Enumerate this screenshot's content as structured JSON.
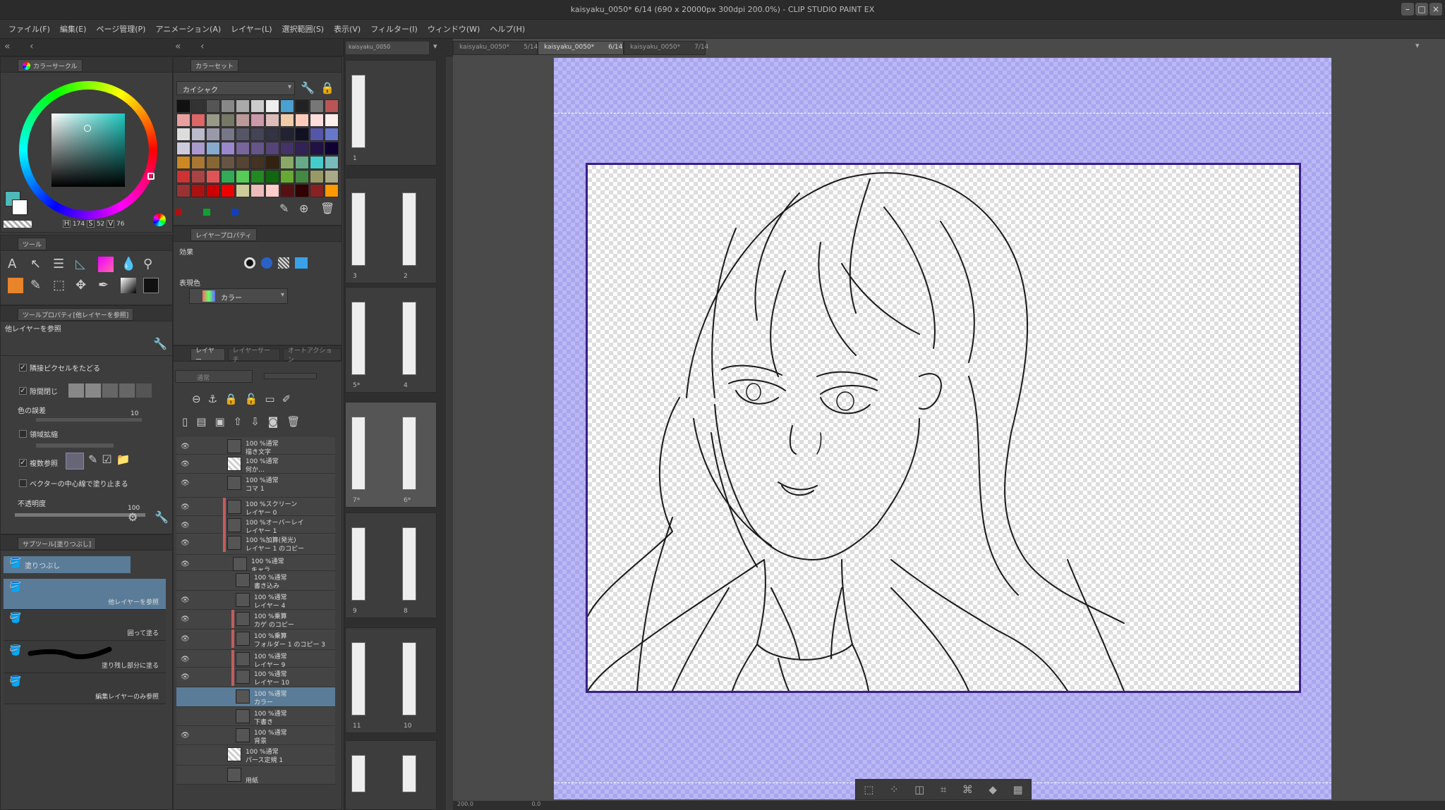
{
  "window": {
    "title": "kaisyaku_0050* 6/14 (690 x 20000px 300dpi 200.0%) - CLIP STUDIO PAINT EX"
  },
  "menu": [
    "ファイル(F)",
    "編集(E)",
    "ページ管理(P)",
    "アニメーション(A)",
    "レイヤー(L)",
    "選択範囲(S)",
    "表示(V)",
    "フィルター(I)",
    "ウィンドウ(W)",
    "ヘルプ(H)"
  ],
  "color_panel": {
    "tab": "カラーサークル",
    "h": "174",
    "s": "52",
    "v": "76",
    "h_label": "H",
    "s_label": "S",
    "v_label": "V",
    "main_color": "#4fb8b8",
    "sub_color": "#ffffff"
  },
  "color_set": {
    "tab": "カラーセット",
    "set_name": "カイシャク"
  },
  "tool_panel": {
    "tab": "ツール"
  },
  "tool_property": {
    "tab": "ツールプロパティ[他レイヤーを参照]",
    "header": "他レイヤーを参照",
    "opt1": "隣接ピクセルをたどる",
    "opt2": "隙間閉じ",
    "opt3": "色の誤差",
    "opt3_value": "10",
    "opt4": "領域拡縮",
    "opt5": "複数参照",
    "opt6": "ベクターの中心線で塗り止まる",
    "opt7": "不透明度",
    "opt7_value": "100"
  },
  "sub_tool": {
    "tab": "サブツール[塗りつぶし]",
    "header": "塗りつぶし",
    "items": [
      "他レイヤーを参照",
      "囲って塗る",
      "塗り残し部分に塗る",
      "編集レイヤーのみ参照"
    ]
  },
  "layer_property": {
    "tab": "レイヤープロパティ",
    "effect_label": "効果",
    "expression_label": "表現色",
    "expression_value": "カラー"
  },
  "layer_panel": {
    "tabs": [
      "レイヤー",
      "レイヤーサーチ",
      "オートアクション"
    ],
    "blend": "通常",
    "layers": [
      {
        "mode": "100 %通常",
        "name": "描き文字"
      },
      {
        "mode": "100 %通常",
        "name": "何か…"
      },
      {
        "mode": "100 %通常",
        "name": "コマ 1"
      },
      {
        "mode": "100 %スクリーン",
        "name": "レイヤー 0"
      },
      {
        "mode": "100 %オーバーレイ",
        "name": "レイヤー 1"
      },
      {
        "mode": "100 %加算(発光)",
        "name": "レイヤー 1 のコピー"
      },
      {
        "mode": "100 %通常",
        "name": "キャラ"
      },
      {
        "mode": "100 %通常",
        "name": "書き込み"
      },
      {
        "mode": "100 %通常",
        "name": "レイヤー 4"
      },
      {
        "mode": "100 %乗算",
        "name": "カゲ のコピー"
      },
      {
        "mode": "100 %乗算",
        "name": "フォルダー 1 のコピー 3"
      },
      {
        "mode": "100 %通常",
        "name": "レイヤー 9"
      },
      {
        "mode": "100 %通常",
        "name": "レイヤー 10"
      },
      {
        "mode": "100 %通常",
        "name": "カラー"
      },
      {
        "mode": "100 %通常",
        "name": "下書き"
      },
      {
        "mode": "100 %通常",
        "name": "背景"
      },
      {
        "mode": "100 %通常",
        "name": "パース定規 1"
      },
      {
        "mode": "",
        "name": "用紙"
      }
    ]
  },
  "page_manager": {
    "tab": "kaisyaku_0050",
    "pages": [
      "1",
      "3",
      "2",
      "5*",
      "4",
      "7*",
      "6*",
      "9",
      "8",
      "11",
      "10"
    ]
  },
  "canvas_tabs": [
    {
      "name": "kaisyaku_0050*",
      "page": "5/14"
    },
    {
      "name": "kaisyaku_0050*",
      "page": "6/14"
    },
    {
      "name": "kaisyaku_0050*",
      "page": "7/14"
    }
  ],
  "status": {
    "zoom": "200.0",
    "angle": "0.0"
  },
  "colors": {
    "frame_bg": "#a9a6ee",
    "frame_border": "#3a1f8a"
  }
}
